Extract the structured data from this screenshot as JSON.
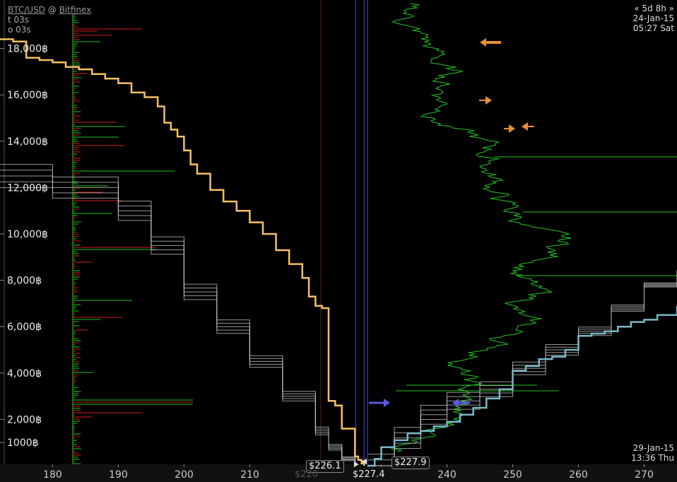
{
  "header": {
    "pair": "BTC/USD",
    "at": "@",
    "exchange": "Bitfinex",
    "t_label": "t 03s",
    "o_label": "o 03s"
  },
  "top_right": {
    "range": "« 5d 8h »",
    "date": "24-Jan-15",
    "time": "05:27 Sat"
  },
  "bottom_right": {
    "date": "29-Jan-15",
    "time": "13:36 Thu"
  },
  "price_tags": {
    "left": "$226.1",
    "right": "$227.9",
    "center": "$227.4",
    "faded": "$220"
  },
  "colors": {
    "ask_depth": "#f5c065",
    "bid_depth": "#7ab8c8",
    "history": "#c8c8c8",
    "volume_green": "#22c322",
    "volume_red": "#d21e1e",
    "arrow_orange": "#e8903a",
    "arrow_blue": "#5a5ae6",
    "price_line": "#5050c8"
  },
  "chart_data": {
    "type": "line",
    "xlabel": "",
    "ylabel": "",
    "xlim": [
      172,
      275
    ],
    "ylim": [
      0,
      18500
    ],
    "x_ticks": [
      180,
      190,
      200,
      210,
      220,
      230,
      240,
      250,
      260,
      270
    ],
    "x_tick_labels": [
      "180",
      "190",
      "200",
      "210",
      "",
      "",
      "240",
      "250",
      "260",
      "270"
    ],
    "y_ticks": [
      1000,
      2000,
      4000,
      6000,
      8000,
      10000,
      12000,
      14000,
      16000,
      18000
    ],
    "y_tick_labels": [
      "1000฿",
      "2,000฿",
      "4,000฿",
      "6,000฿",
      "8,000฿",
      "10,000฿",
      "12,000฿",
      "14,000฿",
      "16,000฿",
      "18,000฿"
    ],
    "grid": false,
    "series": [
      {
        "role": "ask_cumulative_depth",
        "x": [
          172,
          174,
          176,
          178,
          180,
          182,
          184,
          186,
          188,
          190,
          192,
          194,
          196,
          197,
          198,
          199,
          200,
          201,
          202,
          204,
          206,
          208,
          210,
          212,
          214,
          216,
          218,
          219,
          220,
          221,
          222,
          223,
          224,
          225,
          226,
          226.5,
          227,
          227.4
        ],
        "y": [
          18400,
          18300,
          17600,
          17500,
          17400,
          17200,
          17100,
          16900,
          16700,
          16500,
          16100,
          15900,
          15500,
          14800,
          14500,
          14200,
          13600,
          13000,
          12600,
          11900,
          11400,
          11000,
          10500,
          10000,
          9300,
          8700,
          8100,
          7300,
          6900,
          6800,
          2800,
          2600,
          1600,
          1600,
          400,
          250,
          100,
          0
        ]
      },
      {
        "role": "bid_cumulative_depth",
        "x": [
          227.9,
          229,
          230,
          232,
          234,
          236,
          238,
          240,
          242,
          244,
          246,
          248,
          250,
          252,
          254,
          256,
          258,
          260,
          262,
          264,
          266,
          268,
          270,
          272,
          275
        ],
        "y": [
          0,
          300,
          800,
          1100,
          1400,
          1500,
          1700,
          1900,
          2200,
          2500,
          2900,
          3300,
          4100,
          4300,
          4600,
          4700,
          5000,
          5600,
          5700,
          5800,
          6000,
          6200,
          6300,
          6500,
          6900
        ]
      },
      {
        "role": "historical_depth_left",
        "x": [
          172,
          180,
          190,
          195,
          200,
          205,
          210,
          215,
          220,
          222,
          224,
          226
        ],
        "y": [
          12500,
          12000,
          11000,
          9500,
          7500,
          6000,
          4500,
          3000,
          1500,
          800,
          300,
          0
        ]
      },
      {
        "role": "historical_depth_right",
        "x": [
          228,
          232,
          236,
          240,
          245,
          250,
          255,
          260,
          265,
          270,
          275
        ],
        "y": [
          0,
          1200,
          2200,
          2800,
          3300,
          4200,
          5000,
          5800,
          6800,
          7800,
          8400
        ]
      }
    ]
  }
}
